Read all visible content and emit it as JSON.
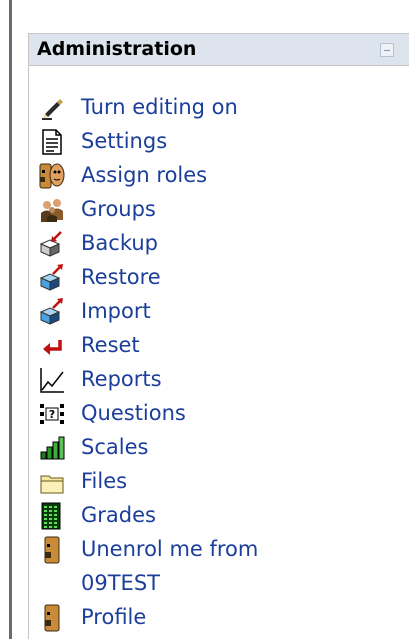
{
  "block": {
    "title": "Administration",
    "items": [
      {
        "label": "Turn editing on",
        "icon": "edit-pen-icon"
      },
      {
        "label": "Settings",
        "icon": "settings-document-icon"
      },
      {
        "label": "Assign roles",
        "icon": "roles-icon"
      },
      {
        "label": "Groups",
        "icon": "groups-icon"
      },
      {
        "label": "Backup",
        "icon": "backup-icon"
      },
      {
        "label": "Restore",
        "icon": "restore-icon"
      },
      {
        "label": "Import",
        "icon": "import-icon"
      },
      {
        "label": "Reset",
        "icon": "reset-arrow-icon"
      },
      {
        "label": "Reports",
        "icon": "reports-graph-icon"
      },
      {
        "label": "Questions",
        "icon": "questions-icon"
      },
      {
        "label": "Scales",
        "icon": "scales-bar-icon"
      },
      {
        "label": "Files",
        "icon": "folder-icon"
      },
      {
        "label": "Grades",
        "icon": "grades-icon"
      },
      {
        "label": "Unenrol me from",
        "label_line2": "09TEST",
        "icon": "user-icon"
      },
      {
        "label": "Profile",
        "icon": "profile-icon"
      }
    ]
  },
  "colors": {
    "link": "#1b3e9a",
    "header_bg": "#dde4ee",
    "border": "#c6c6c6"
  }
}
